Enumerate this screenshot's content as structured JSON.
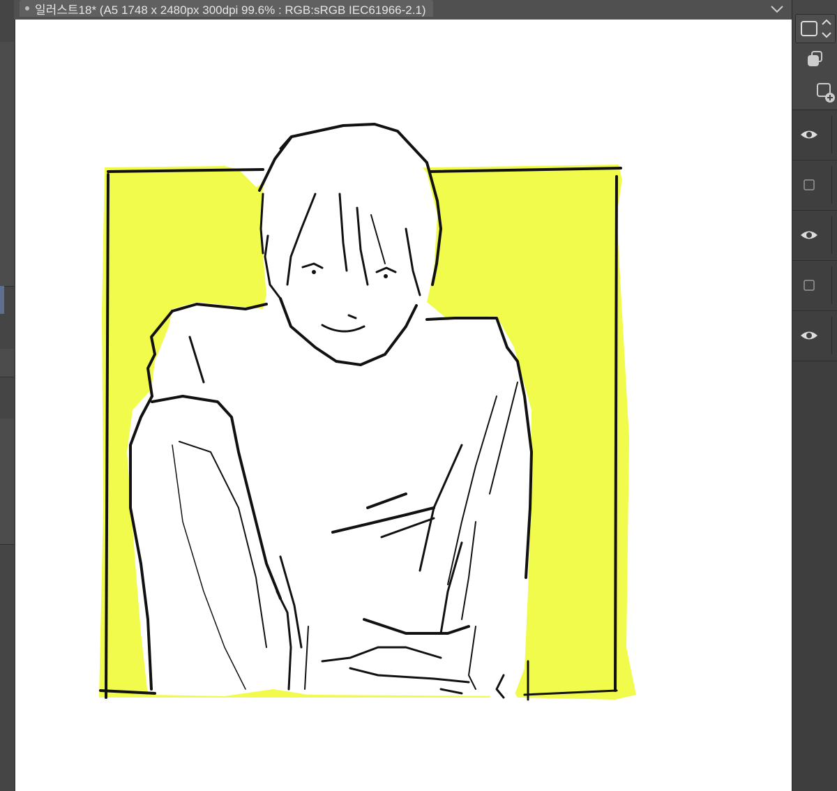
{
  "window": {
    "tab_title": "일러스트18* (A5 1748 x 2480px 300dpi 99.6% : RGB:sRGB IEC61966-2.1)",
    "tab_menu_icon": "chevron-down-icon"
  },
  "layers_panel": {
    "header_icons": [
      "square-select-icon",
      "copy-layer-icon",
      "add-layer-icon"
    ],
    "rows": [
      {
        "visible": true,
        "icon": "eye-icon"
      },
      {
        "visible": false,
        "icon": "checkbox-icon"
      },
      {
        "visible": true,
        "icon": "eye-icon"
      },
      {
        "visible": false,
        "icon": "checkbox-icon"
      },
      {
        "visible": true,
        "icon": "eye-icon"
      }
    ]
  },
  "canvas": {
    "artwork": "sketch-illustration",
    "background_color": "#ffffff",
    "fill_color": "#f0fb4c",
    "line_color": "#111111"
  }
}
